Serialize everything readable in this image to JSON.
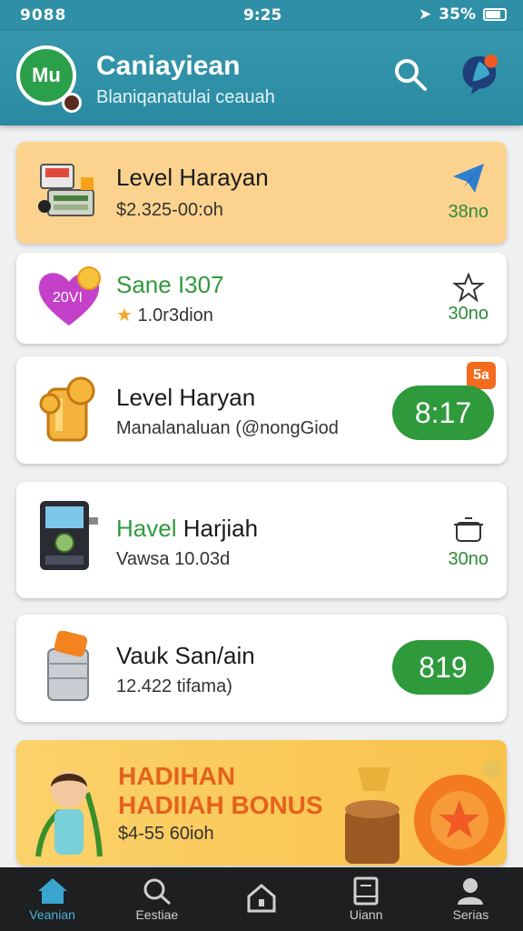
{
  "status_bar": {
    "left": "9088",
    "time": "9:25",
    "battery": "35%"
  },
  "header": {
    "logo_text": "Mu",
    "title": "Caniayiean",
    "subtitle": "Blaniqanatulai ceauah",
    "search_icon": "search-icon",
    "chat_icon": "chat-icon"
  },
  "cards": [
    {
      "title": "Level Harayan",
      "sub": "$2.325-00:oh",
      "value": "38no",
      "icon": "paper-plane-icon",
      "bg": "#fcd38e"
    },
    {
      "title": "Sane I307",
      "sub": "1.0r3dion",
      "value": "30no",
      "icon": "star-outline-icon",
      "art_label": "20VI"
    },
    {
      "title": "Level Haryan",
      "sub": "Manalanaluan (@nongGiod",
      "pill": "8:17",
      "corner_badge": "5a"
    },
    {
      "title_green": "Havel",
      "title_rest": " Harjiah",
      "sub": "Vawsa 10.03d",
      "value": "30no",
      "icon": "pot-icon"
    },
    {
      "title": "Vauk San/ain",
      "sub": "12.422 tifama)",
      "pill": "819"
    }
  ],
  "bonus": {
    "line1": "HADIHAN",
    "line2": "HADIIAH BONUS",
    "line3": "$4-55 60ioh"
  },
  "nav": [
    {
      "label": "Veanian",
      "icon": "home-icon"
    },
    {
      "label": "Eestiae",
      "icon": "search-icon"
    },
    {
      "label": "",
      "icon": "house-outline-icon"
    },
    {
      "label": "Uiann",
      "icon": "book-icon"
    },
    {
      "label": "Serias",
      "icon": "person-icon"
    }
  ]
}
